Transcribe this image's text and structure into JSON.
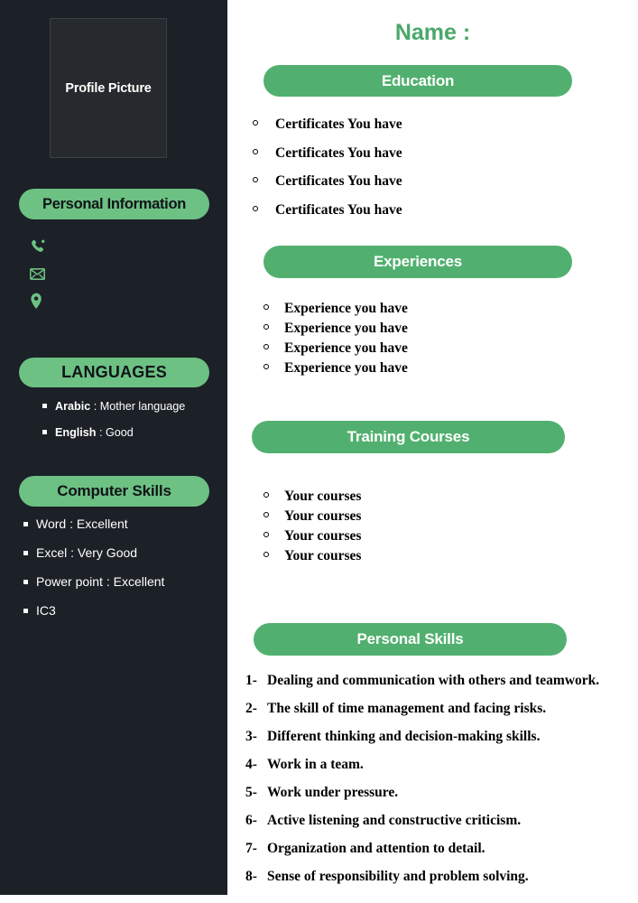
{
  "theme": {
    "sidebar_bg": "#1c2027",
    "sidebar_pill_green": "#6cc183",
    "main_pill_green": "#51b06f",
    "name_green": "#4aa869",
    "page_bg": "#ffffff"
  },
  "sidebar": {
    "profile_picture_label": "Profile Picture",
    "personal_information_label": "Personal Information",
    "contact_icons": [
      {
        "name": "phone-icon"
      },
      {
        "name": "email-icon"
      },
      {
        "name": "location-icon"
      }
    ],
    "languages": {
      "heading": "LANGUAGES",
      "items": [
        {
          "name": "Arabic",
          "separator": " : ",
          "level": "Mother language"
        },
        {
          "name": "English",
          "separator": " : ",
          "level": "Good"
        }
      ]
    },
    "computer_skills": {
      "heading": "Computer Skills",
      "items": [
        "Word : Excellent",
        "Excel : Very Good",
        "Power point : Excellent",
        "IC3"
      ]
    }
  },
  "main": {
    "name_title": "Name :",
    "education": {
      "heading": "Education",
      "items": [
        "Certificates You have",
        "Certificates You have",
        "Certificates You have",
        "Certificates You have"
      ]
    },
    "experiences": {
      "heading": "Experiences",
      "items": [
        "Experience you have",
        "Experience you have",
        "Experience you have",
        "Experience you have"
      ]
    },
    "training_courses": {
      "heading": "Training Courses",
      "items": [
        "Your courses",
        "Your courses",
        "Your courses",
        "Your courses"
      ]
    },
    "personal_skills": {
      "heading": "Personal Skills",
      "items": [
        {
          "marker": "1-",
          "text": "Dealing and communication with others and teamwork."
        },
        {
          "marker": "2-",
          "text": "The skill of time management and facing risks."
        },
        {
          "marker": "3-",
          "text": "Different thinking and decision-making skills."
        },
        {
          "marker": "4-",
          "text": "Work in a team."
        },
        {
          "marker": "5-",
          "text": "Work under pressure."
        },
        {
          "marker": "6-",
          "text": "Active listening and constructive criticism."
        },
        {
          "marker": "7-",
          "text": "Organization and attention to detail."
        },
        {
          "marker": "8-",
          "text": "Sense of responsibility and problem solving."
        }
      ]
    }
  }
}
